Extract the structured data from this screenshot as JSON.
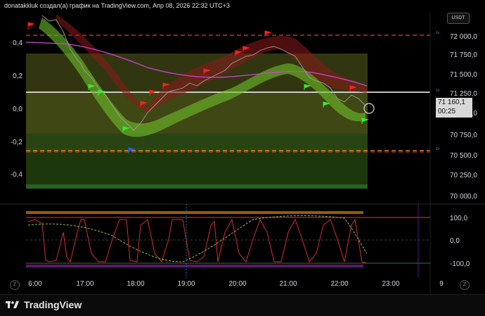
{
  "header": {
    "caption": "donatakkluk создал(а) график на TradingView.com, Апр 08, 2026 22:32 UTC+3"
  },
  "currency_label": "USDT",
  "last_price": {
    "value": "71 160,1",
    "countdown": "00:25"
  },
  "price_axis": [
    "72 000,0",
    "71 750,0",
    "71 500,0",
    "71 250,0",
    "71 000,0",
    "70 750,0",
    "70 500,0",
    "70 250,0",
    "70 000,0"
  ],
  "left_axis": [
    "0,4",
    "0,2",
    "0,0",
    "-0,2",
    "-0,4"
  ],
  "osc_axis": [
    "100,0",
    "0,0",
    "-100,0"
  ],
  "time_axis": [
    "6:00",
    "17:00",
    "18:00",
    "19:00",
    "20:00",
    "21:00",
    "22:00",
    "23:00",
    "9"
  ],
  "brand": {
    "name": "TradingView"
  },
  "buttons": {
    "left_z": "Z",
    "right_z": "Z"
  },
  "colors": {
    "red_line": "#e53935",
    "orange_line": "#ff9800",
    "white_line": "#ffffff",
    "green_band": "#4caf50",
    "olive_fill": "#3d4a1a"
  }
}
